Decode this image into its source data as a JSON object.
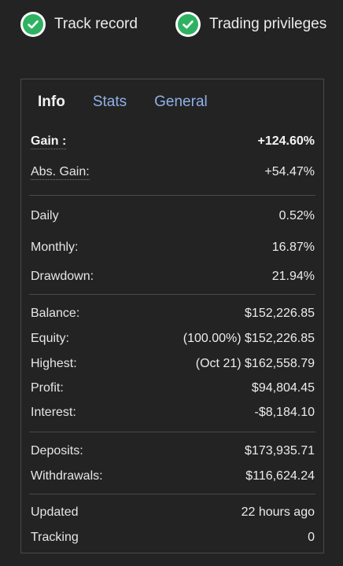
{
  "badges": [
    {
      "label": "Track record",
      "icon": "check-circle-icon"
    },
    {
      "label": "Trading privileges",
      "icon": "check-circle-icon"
    }
  ],
  "colors": {
    "background": "#232323",
    "accent_link": "#8fb1e8",
    "check_green": "#2eb262",
    "border": "#4a4a4a"
  },
  "tabs": [
    {
      "label": "Info",
      "active": true
    },
    {
      "label": "Stats",
      "active": false
    },
    {
      "label": "General",
      "active": false
    }
  ],
  "info": {
    "gain_label": "Gain :",
    "gain_value": "+124.60%",
    "abs_gain_label": "Abs. Gain:",
    "abs_gain_value": "+54.47%",
    "daily_label": "Daily",
    "daily_value": "0.52%",
    "monthly_label": "Monthly:",
    "monthly_value": "16.87%",
    "drawdown_label": "Drawdown:",
    "drawdown_value": "21.94%",
    "balance_label": "Balance:",
    "balance_value": "$152,226.85",
    "equity_label": "Equity:",
    "equity_value": "(100.00%) $152,226.85",
    "highest_label": "Highest:",
    "highest_value": "(Oct 21) $162,558.79",
    "profit_label": "Profit:",
    "profit_value": "$94,804.45",
    "interest_label": "Interest:",
    "interest_value": "-$8,184.10",
    "deposits_label": "Deposits:",
    "deposits_value": "$173,935.71",
    "withdrawals_label": "Withdrawals:",
    "withdrawals_value": "$116,624.24",
    "updated_label": "Updated",
    "updated_value": "22 hours ago",
    "tracking_label": "Tracking",
    "tracking_value": "0"
  }
}
